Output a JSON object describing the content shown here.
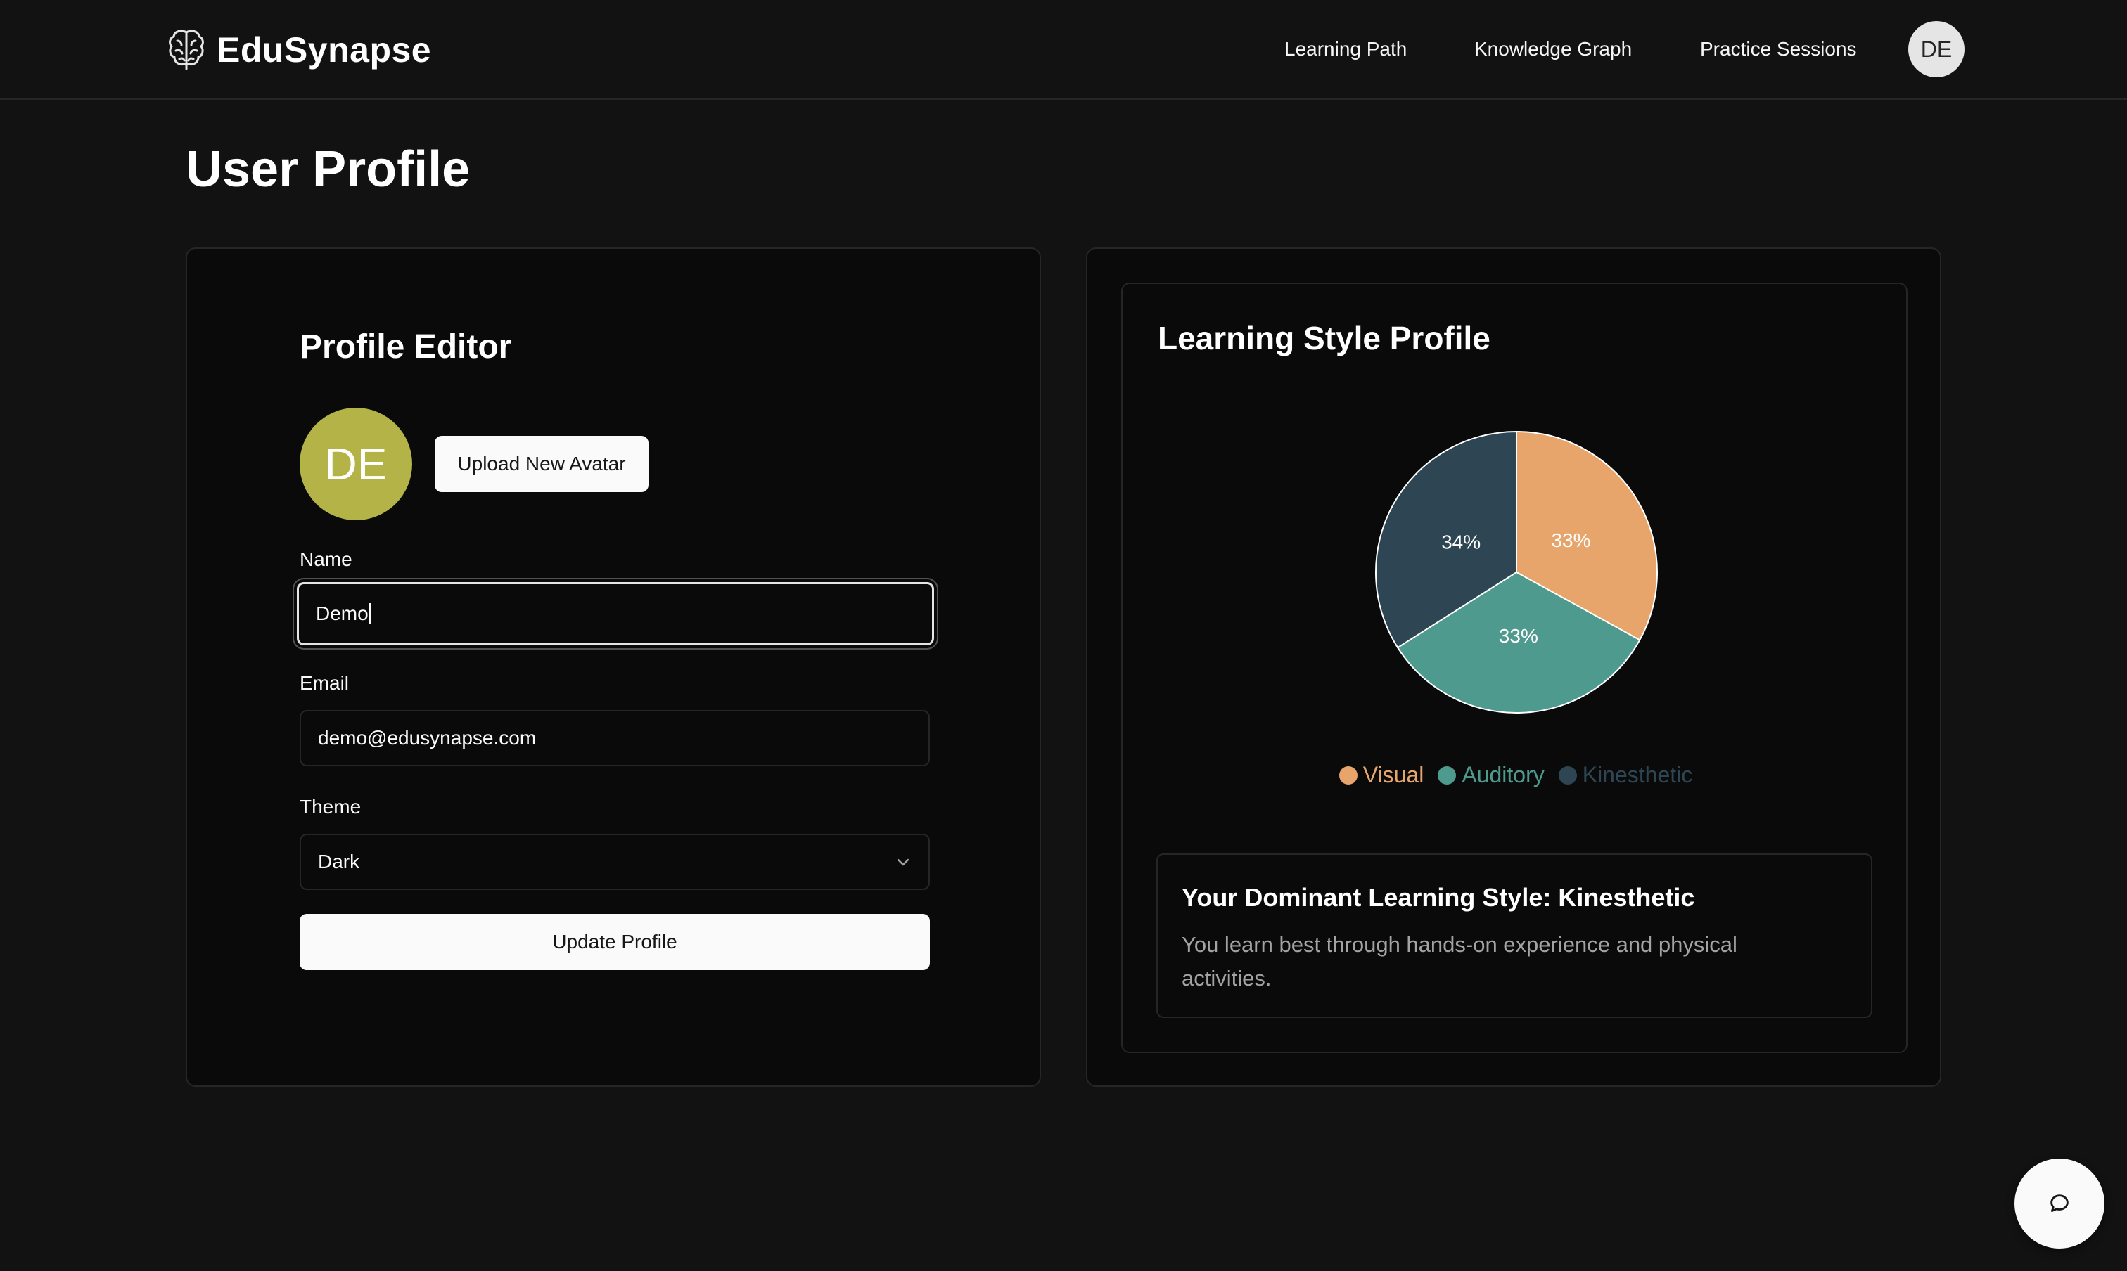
{
  "app": {
    "name": "EduSynapse",
    "logo_icon": "brain-icon"
  },
  "nav": {
    "links": [
      "Learning Path",
      "Knowledge Graph",
      "Practice Sessions"
    ],
    "avatar_initials": "DE"
  },
  "page": {
    "title": "User Profile"
  },
  "profile_editor": {
    "title": "Profile Editor",
    "avatar_initials": "DE",
    "avatar_color": "#b3b347",
    "upload_label": "Upload New Avatar",
    "name_label": "Name",
    "name_value": "Demo",
    "email_label": "Email",
    "email_value": "demo@edusynapse.com",
    "theme_label": "Theme",
    "theme_value": "Dark",
    "update_label": "Update Profile"
  },
  "learning_style": {
    "title": "Learning Style Profile",
    "dominant_title": "Your Dominant Learning Style: Kinesthetic",
    "dominant_description": "You learn best through hands-on experience and physical activities."
  },
  "chart_data": {
    "type": "pie",
    "title": "",
    "legend_position": "bottom",
    "slices": [
      {
        "label": "Visual",
        "value": 33,
        "display": "33%",
        "color": "#e8a56b"
      },
      {
        "label": "Auditory",
        "value": 33,
        "display": "33%",
        "color": "#4f9a8e"
      },
      {
        "label": "Kinesthetic",
        "value": 34,
        "display": "34%",
        "color": "#2e4653"
      }
    ]
  },
  "chat": {
    "icon": "chat-bubble-icon"
  }
}
